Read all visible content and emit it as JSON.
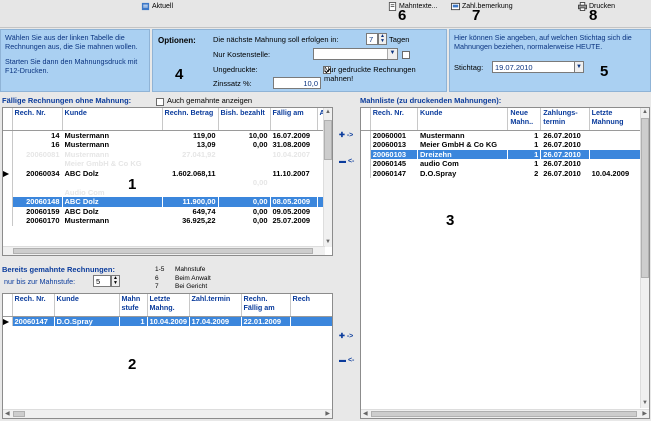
{
  "toolbar": {
    "aktuell": "Aktuell",
    "mahntexte": "Mahntexte...",
    "zahlbemerkung": "Zahl.bemerkung",
    "drucken": "Drucken"
  },
  "markers": {
    "m1": "1",
    "m2": "2",
    "m3": "3",
    "m4": "4",
    "m5": "5",
    "m6": "6",
    "m7": "7",
    "m8": "8"
  },
  "info_left": {
    "line1": "Wählen Sie aus der linken Tabelle die Rechnungen aus, die Sie mahnen wollen.",
    "line2": "Starten Sie dann den Mahnungsdruck mit F12-Drucken."
  },
  "options": {
    "title": "Optionen:",
    "next_reminder_label": "Die nächste Mahnung soll erfolgen in:",
    "next_reminder_value": "7",
    "days_label": "Tagen",
    "cost_center_label": "Nur Kostenstelle:",
    "unprinted_label": "Ungedruckte:",
    "unprinted_text": "Nur gedruckte Rechnungen mahnen!",
    "interest_label": "Zinssatz %:",
    "interest_value": "10,0"
  },
  "info_right": {
    "text": "Hier können Sie angeben, auf welchen Stichtag sich die Mahnungen beziehen, normalerweise HEUTE.",
    "date_label": "Stichtag:",
    "date_value": "19.07.2010"
  },
  "due": {
    "title": "Fällige Rechnungen ohne Mahnung:",
    "also_label": "Auch gemahnte anzeigen",
    "columns": [
      "Rech. Nr.",
      "Kunde",
      "Rechn. Betrag",
      "Bish. bezahlt",
      "Fällig am",
      "A"
    ],
    "rows": [
      {
        "nr": "14",
        "kunde": "Mustermann",
        "betrag": "119,00",
        "bezahlt": "10,00",
        "faellig": "16.07.2009",
        "state": ""
      },
      {
        "nr": "16",
        "kunde": "Mustermann",
        "betrag": "13,09",
        "bezahlt": "0,00",
        "faellig": "31.08.2009",
        "state": ""
      },
      {
        "nr": "20060081",
        "kunde": "Mustermann",
        "betrag": "27.041,92",
        "bezahlt": "",
        "faellig": "10.04.2007",
        "state": "faded"
      },
      {
        "nr": "",
        "kunde": "Meier GmbH & Co KG",
        "betrag": "",
        "bezahlt": "",
        "faellig": "",
        "state": "faded"
      },
      {
        "nr": "20060034",
        "kunde": "ABC Dolz",
        "betrag": "1.602.068,11",
        "bezahlt": "",
        "faellig": "11.10.2007",
        "state": "current"
      },
      {
        "nr": "",
        "kunde": "",
        "betrag": "",
        "bezahlt": "0,00",
        "faellig": "",
        "state": "faded"
      },
      {
        "nr": "",
        "kunde": "Audio Com",
        "betrag": "",
        "bezahlt": "",
        "faellig": "",
        "state": "faded"
      },
      {
        "nr": "20060148",
        "kunde": "ABC Dolz",
        "betrag": "11.900,00",
        "bezahlt": "0,00",
        "faellig": "08.05.2009",
        "state": "sel"
      },
      {
        "nr": "20060159",
        "kunde": "ABC Dolz",
        "betrag": "649,74",
        "bezahlt": "0,00",
        "faellig": "09.05.2009",
        "state": ""
      },
      {
        "nr": "20060170",
        "kunde": "Mustermann",
        "betrag": "36.925,22",
        "bezahlt": "0,00",
        "faellig": "25.07.2009",
        "state": ""
      }
    ]
  },
  "legend": {
    "title": "Bereits gemahnte Rechnungen:",
    "level_label": "nur bis zur Mahnstufe:",
    "level_value": "5",
    "l1": "1-5",
    "l1t": "Mahnstufe",
    "l2": "6",
    "l2t": "Beim Anwalt",
    "l3": "7",
    "l3t": "Bei Gericht"
  },
  "dunned": {
    "columns": [
      "Rech. Nr.",
      "Kunde",
      "Mahn stufe",
      "Letzte Mahng.",
      "Zahl.termin",
      "Rechn. Fällig am",
      "Rech"
    ],
    "rows": [
      {
        "nr": "20060147",
        "kunde": "D.O.Spray",
        "stufe": "1",
        "letzte": "10.04.2009",
        "termin": "17.04.2009",
        "faellig": "22.01.2009"
      }
    ]
  },
  "mahnliste": {
    "title": "Mahnliste (zu druckenden Mahnungen):",
    "columns": [
      "Rech. Nr.",
      "Kunde",
      "Neue Mahn..",
      "Zahlungs- termin",
      "Letzte Mahnung"
    ],
    "rows": [
      {
        "nr": "20060001",
        "kunde": "Mustermann",
        "neue": "1",
        "termin": "26.07.2010",
        "letzte": "",
        "state": ""
      },
      {
        "nr": "20060013",
        "kunde": "Meier GmbH & Co KG",
        "neue": "1",
        "termin": "26.07.2010",
        "letzte": "",
        "state": ""
      },
      {
        "nr": "20060103",
        "kunde": "Dreizehn",
        "neue": "1",
        "termin": "26.07.2010",
        "letzte": "",
        "state": "sel"
      },
      {
        "nr": "20060145",
        "kunde": "audio Com",
        "neue": "1",
        "termin": "26.07.2010",
        "letzte": "",
        "state": ""
      },
      {
        "nr": "20060147",
        "kunde": "D.O.Spray",
        "neue": "2",
        "termin": "26.07.2010",
        "letzte": "10.04.2009",
        "state": ""
      }
    ]
  },
  "move": {
    "add": "->",
    "remove": "<-"
  },
  "colors": {
    "panel": "#aad0f2",
    "header_text": "#0b3c9c",
    "selection": "#3b86dc"
  }
}
